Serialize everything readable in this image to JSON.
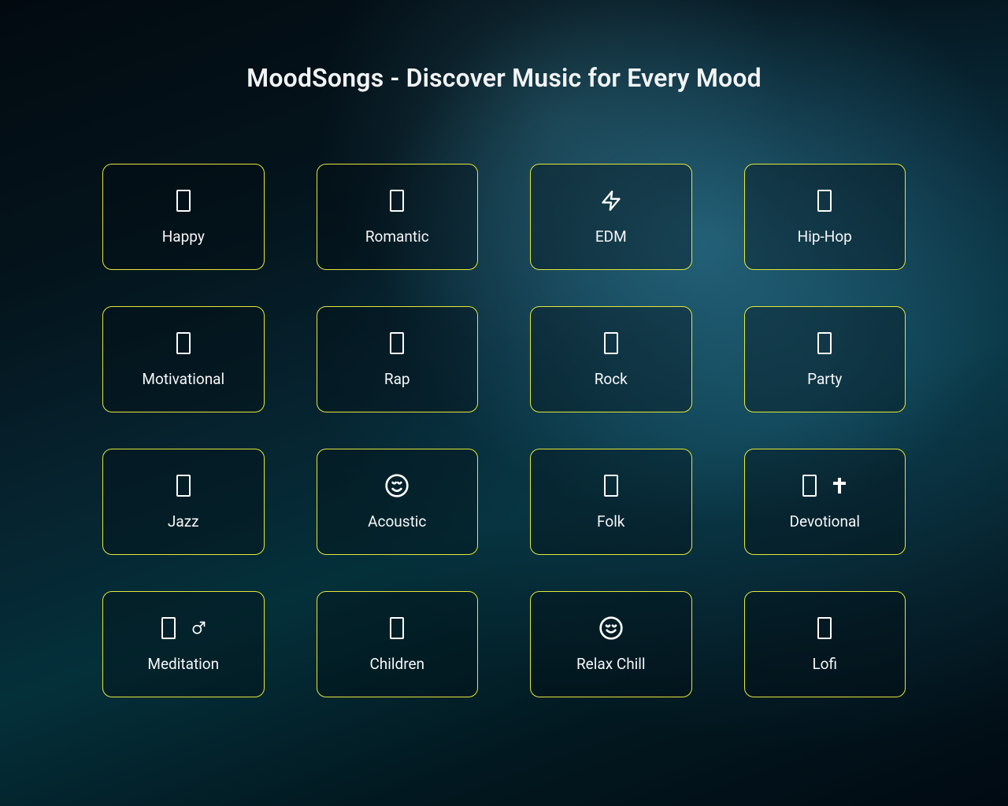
{
  "title": "MoodSongs - Discover Music for Every Mood",
  "colors": {
    "card_border": "#e4e83a",
    "text": "#ffffff"
  },
  "moods": [
    {
      "label": "Happy",
      "icon": "glyph",
      "icon2": null
    },
    {
      "label": "Romantic",
      "icon": "glyph",
      "icon2": null
    },
    {
      "label": "EDM",
      "icon": "lightning",
      "icon2": null
    },
    {
      "label": "Hip-Hop",
      "icon": "glyph",
      "icon2": null
    },
    {
      "label": "Motivational",
      "icon": "glyph",
      "icon2": null
    },
    {
      "label": "Rap",
      "icon": "glyph",
      "icon2": null
    },
    {
      "label": "Rock",
      "icon": "glyph",
      "icon2": null
    },
    {
      "label": "Party",
      "icon": "glyph",
      "icon2": null
    },
    {
      "label": "Jazz",
      "icon": "glyph",
      "icon2": null
    },
    {
      "label": "Acoustic",
      "icon": "smile",
      "icon2": null
    },
    {
      "label": "Folk",
      "icon": "glyph",
      "icon2": null
    },
    {
      "label": "Devotional",
      "icon": "glyph",
      "icon2": "cross"
    },
    {
      "label": "Meditation",
      "icon": "glyph",
      "icon2": "male-symbol"
    },
    {
      "label": "Children",
      "icon": "glyph",
      "icon2": null
    },
    {
      "label": "Relax Chill",
      "icon": "calm-smile",
      "icon2": null
    },
    {
      "label": "Lofi",
      "icon": "glyph",
      "icon2": null
    }
  ]
}
